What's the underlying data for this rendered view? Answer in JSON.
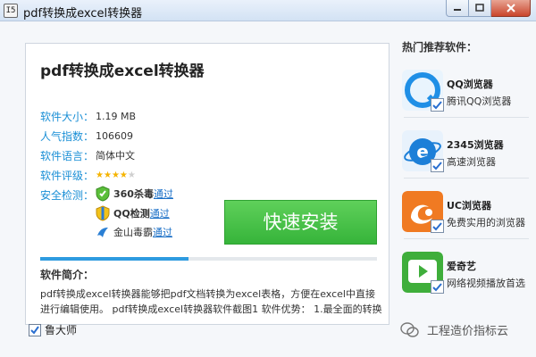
{
  "window": {
    "title": "pdf转换成excel转换器",
    "icon_text": "I5"
  },
  "app": {
    "name": "pdf转换成excel转换器",
    "info": [
      {
        "label": "软件大小：",
        "value": "1.19 MB"
      },
      {
        "label": "人气指数：",
        "value": "106609"
      },
      {
        "label": "软件语言：",
        "value": "简体中文"
      },
      {
        "label": "软件评级：",
        "value": ""
      }
    ],
    "rating": 4,
    "rating_max": 5,
    "security_label": "安全检测：",
    "security": [
      {
        "name": "360杀毒",
        "status": "通过",
        "icon": "360-shield-icon"
      },
      {
        "name": "QQ检测",
        "status": "通过",
        "icon": "qq-shield-icon"
      },
      {
        "name": "金山毒霸",
        "status": "通过",
        "icon": "kingsoft-icon"
      }
    ],
    "install_label": "快速安装",
    "progress": 0.44,
    "intro_title": "软件简介：",
    "intro_text": "pdf转换成excel转换器能够把pdf文档转换为excel表格，方便在excel中直接进行编辑使用。 pdf转换成excel转换器软件截图1 软件优势： 1.最全面的转换"
  },
  "sidebar": {
    "title": "热门推荐软件：",
    "items": [
      {
        "name": "QQ浏览器",
        "desc": "腾讯QQ浏览器",
        "icon": "qq-browser-icon",
        "color": "#1f8fe6",
        "checked": true
      },
      {
        "name": "2345浏览器",
        "desc": "高速浏览器",
        "icon": "2345-browser-icon",
        "color": "#1c7fd8",
        "checked": true
      },
      {
        "name": "UC浏览器",
        "desc": "免费实用的浏览器",
        "icon": "uc-browser-icon",
        "color": "#f07a22",
        "checked": true
      },
      {
        "name": "爱奇艺",
        "desc": "网络视频播放首选",
        "icon": "iqiyi-icon",
        "color": "#3fae3b",
        "checked": true
      }
    ]
  },
  "bottom": {
    "checkbox_label": "鲁大师",
    "checked": true,
    "watermark": "工程造价指标云"
  },
  "colors": {
    "accent": "#1a8fd6",
    "install_green": "#3cb83f",
    "progress": "#2e9be0",
    "link": "#1a6fc7"
  }
}
